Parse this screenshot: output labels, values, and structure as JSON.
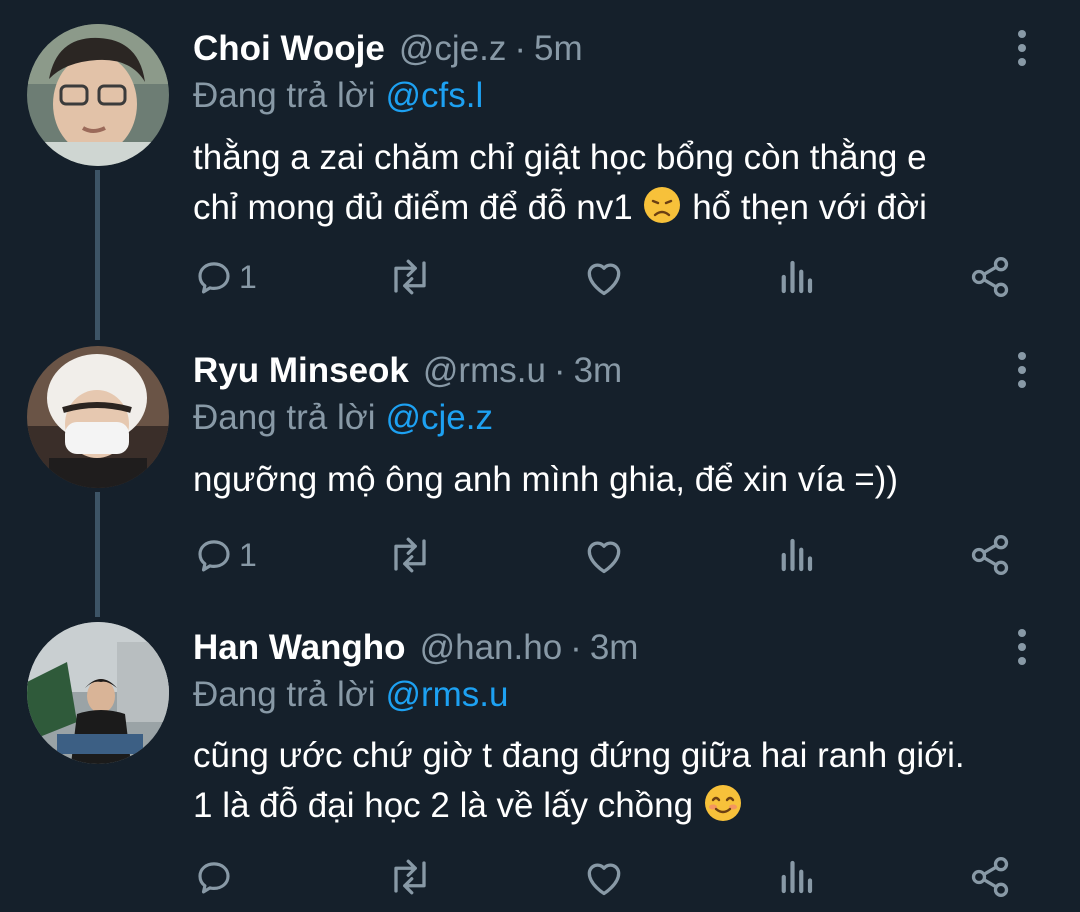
{
  "replying_label": "Đang trả lời",
  "colors": {
    "background": "#15202b",
    "secondary_text": "#8899a6",
    "mention": "#1da1f2",
    "thread_line": "#3d5466"
  },
  "tweets": [
    {
      "display_name": "Choi Wooje",
      "handle": "@cje.z",
      "time": "5m",
      "reply_to": "@cfs.l",
      "text_lines": [
        "thằng a zai chăm chỉ giật học bổng còn thằng e",
        "chỉ mong đủ điểm để đỗ nv1",
        "hổ thẹn với đời"
      ],
      "emoji": "disappointed-face",
      "reply_count": "1"
    },
    {
      "display_name": "Ryu Minseok",
      "handle": "@rms.u",
      "time": "3m",
      "reply_to": "@cje.z",
      "text_lines": [
        "ngưỡng mộ ông anh mình ghia, để xin vía =))"
      ],
      "reply_count": "1"
    },
    {
      "display_name": "Han Wangho",
      "handle": "@han.ho",
      "time": "3m",
      "reply_to": "@rms.u",
      "text_lines": [
        "cũng ước chứ giờ t đang đứng giữa hai ranh giới.",
        "1 là đỗ đại học 2 là về lấy chồng"
      ],
      "emoji": "smiling-face",
      "reply_count": ""
    }
  ],
  "icons": [
    "reply-icon",
    "retweet-icon",
    "like-icon",
    "analytics-icon",
    "share-icon",
    "more-icon"
  ]
}
